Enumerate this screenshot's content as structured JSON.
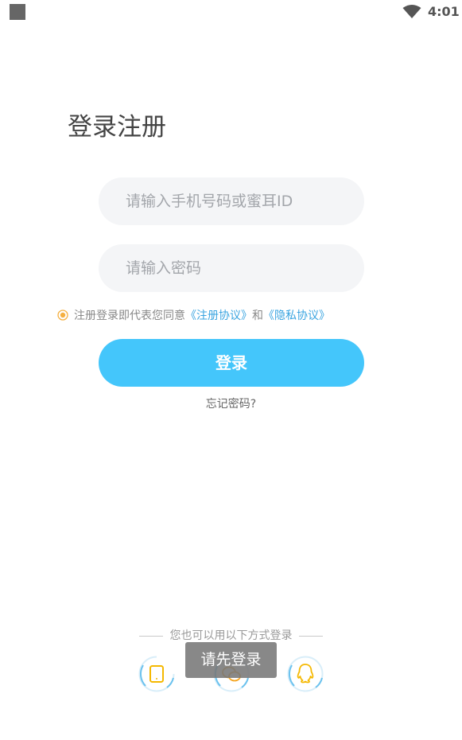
{
  "status_bar": {
    "time": "4:01",
    "icons": [
      "square-icon",
      "wifi-icon"
    ]
  },
  "page": {
    "title": "登录注册"
  },
  "form": {
    "phone_placeholder": "请输入手机号码或蜜耳ID",
    "phone_value": "",
    "password_placeholder": "请输入密码",
    "password_value": ""
  },
  "agreement": {
    "prefix": "注册登录即代表您同意",
    "register_link": "《注册协议》",
    "conjunction": "和",
    "privacy_link": "《隐私协议》"
  },
  "actions": {
    "login_label": "登录",
    "forgot_label": "忘记密码?"
  },
  "alt_login": {
    "label": "您也可以用以下方式登录",
    "methods": [
      "phone-icon",
      "wechat-icon",
      "qq-icon"
    ]
  },
  "toast": {
    "message": "请先登录"
  },
  "colors": {
    "accent": "#44c6fb",
    "link": "#3aa4e0",
    "radio": "#f5b041",
    "input_bg": "#f4f5f7",
    "phone_icon": "#f5b800",
    "wechat_icon": "#f5a623",
    "qq_icon": "#f5b800"
  }
}
